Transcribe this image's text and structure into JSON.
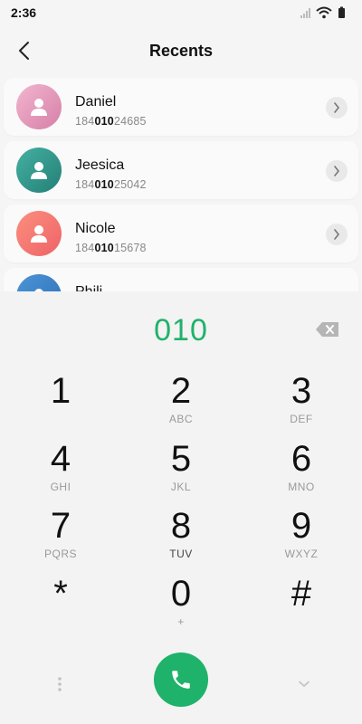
{
  "status_bar": {
    "time": "2:36"
  },
  "header": {
    "title": "Recents"
  },
  "recents": [
    {
      "name": "Daniel",
      "number_prefix": "184",
      "number_match": "010",
      "number_suffix": "24685",
      "avatar_color": "#e39ab9"
    },
    {
      "name": "Jeesica",
      "number_prefix": "184",
      "number_match": "010",
      "number_suffix": "25042",
      "avatar_color": "#2f9b8f"
    },
    {
      "name": "Nicole",
      "number_prefix": "184",
      "number_match": "010",
      "number_suffix": "15678",
      "avatar_color": "#f47a6f"
    },
    {
      "name": "Phili",
      "number_prefix": "",
      "number_match": "",
      "number_suffix": "",
      "avatar_color": "#3d83c8"
    }
  ],
  "dialpad": {
    "input_value": "010",
    "keys": [
      {
        "digit": "1",
        "letters": ""
      },
      {
        "digit": "2",
        "letters": "ABC"
      },
      {
        "digit": "3",
        "letters": "DEF"
      },
      {
        "digit": "4",
        "letters": "GHI"
      },
      {
        "digit": "5",
        "letters": "JKL"
      },
      {
        "digit": "6",
        "letters": "MNO"
      },
      {
        "digit": "7",
        "letters": "PQRS"
      },
      {
        "digit": "8",
        "letters": "TUV"
      },
      {
        "digit": "9",
        "letters": "WXYZ"
      },
      {
        "digit": "*",
        "letters": ""
      },
      {
        "digit": "0",
        "letters": "+"
      },
      {
        "digit": "#",
        "letters": ""
      }
    ]
  },
  "colors": {
    "accent": "#1fb26a"
  },
  "icons": {
    "back": "chevron-left-icon",
    "backspace": "backspace-icon",
    "call": "phone-icon",
    "menu": "more-vertical-icon",
    "collapse": "chevron-down-icon",
    "detail": "chevron-right-icon",
    "avatar": "person-icon"
  }
}
